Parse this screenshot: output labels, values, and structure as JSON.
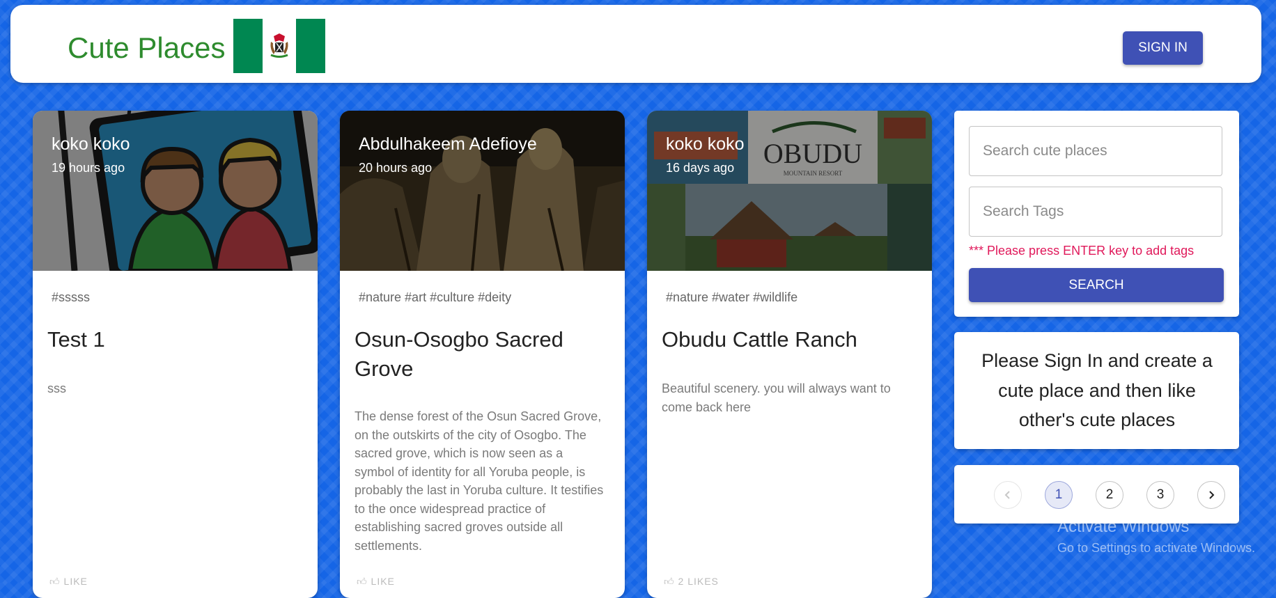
{
  "header": {
    "brand": "Cute Places",
    "signin_label": "SIGN IN"
  },
  "posts": [
    {
      "author": "koko koko",
      "time": "19 hours ago",
      "tags": "#sssss",
      "title": "Test 1",
      "message": "sss",
      "likes": "LIKE"
    },
    {
      "author": "Abdulhakeem Adefioye",
      "time": "20 hours ago",
      "tags": "#nature #art #culture #deity",
      "title": "Osun-Osogbo Sacred Grove",
      "message": "The dense forest of the Osun Sacred Grove, on the outskirts of the city of Osogbo. The sacred grove, which is now seen as a symbol of identity for all Yoruba people, is probably the last in Yoruba culture. It testifies to the once widespread practice of establishing sacred groves outside all settlements.",
      "likes": "LIKE"
    },
    {
      "author": "koko koko",
      "time": "16 days ago",
      "tags": "#nature #water #wildlife",
      "title": "Obudu Cattle Ranch",
      "message": "Beautiful scenery. you will always want to come back here",
      "likes": "2 LIKES",
      "image_text": {
        "logo": "OBUDU",
        "logo_sub": "MOUNTAIN RESORT"
      }
    }
  ],
  "search": {
    "places_placeholder": "Search cute places",
    "tags_placeholder": "Search Tags",
    "hint": "*** Please press ENTER key to add tags",
    "button_label": "SEARCH"
  },
  "signin_prompt": "Please Sign In and create a cute place and then like other's cute places",
  "pagination": {
    "pages": [
      "1",
      "2",
      "3"
    ],
    "current": "1"
  },
  "watermark": {
    "line1": "Activate Windows",
    "line2": "Go to Settings to activate Windows."
  },
  "colors": {
    "brand": "#2e8b2e",
    "primary": "#3f51b5",
    "hint": "#e0185a",
    "background": "#1565e6"
  }
}
